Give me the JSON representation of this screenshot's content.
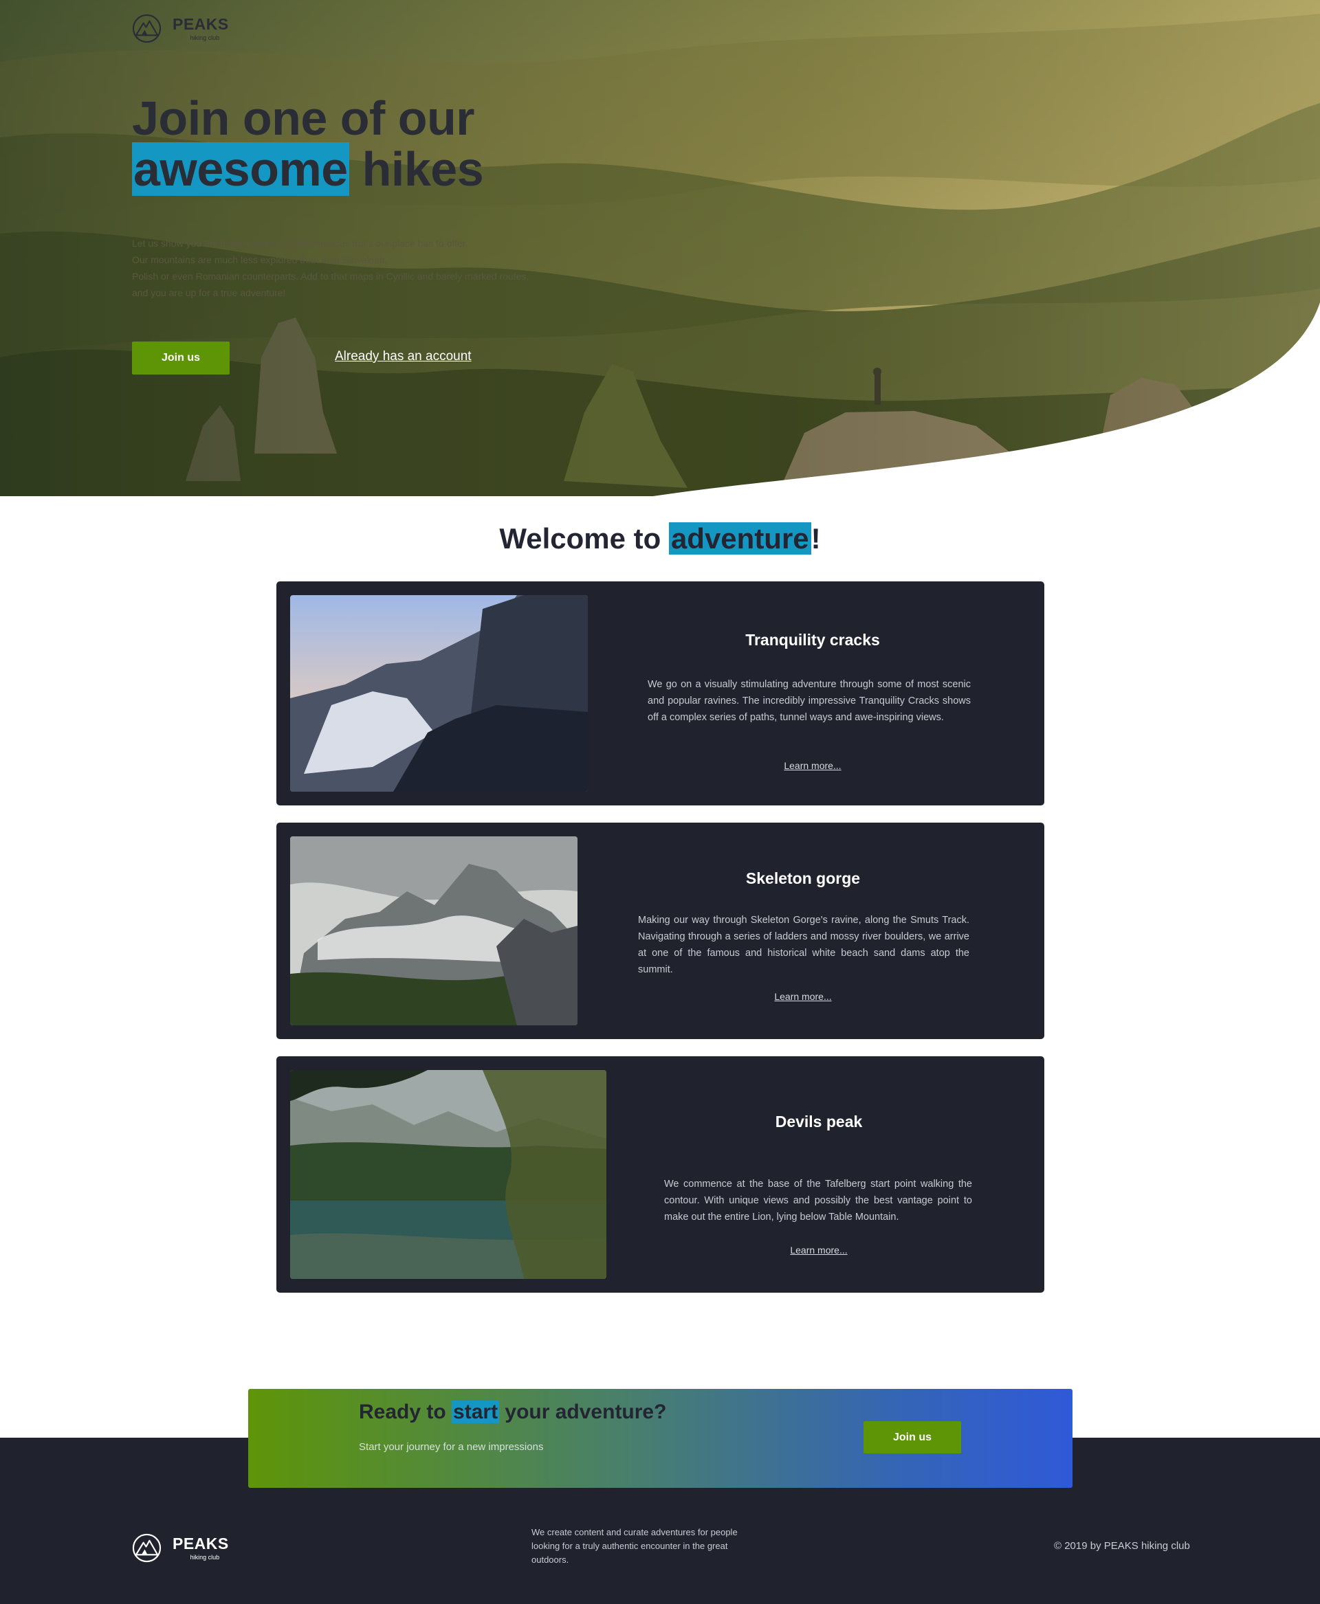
{
  "brand": {
    "name": "PEAKS",
    "sub": "hiking club"
  },
  "hero": {
    "title_line1": "Join one of our",
    "title_highlight": "awesome",
    "title_rest": " hikes",
    "text_lines": [
      "Let us show you the hidden gems and adventurous trails our place has to offer.",
      "Our mountains are much less explored than their Slovakian,",
      "Polish or even Romanian counterparts. Add to that maps in Cyrillic and barely marked routes,",
      "and you are up for a true adventure!"
    ],
    "join_label": "Join us",
    "account_link": "Already has an account"
  },
  "welcome": {
    "prefix": "Welcome to ",
    "highlight": "adventure",
    "suffix": "!"
  },
  "cards": [
    {
      "title": "Tranquility cracks",
      "description": "We go on a visually stimulating adventure through some of most scenic and popular ravines. The incredibly impressive Tranquility Cracks shows off a complex series of paths, tunnel ways and awe-inspiring views.",
      "link": "Learn more..."
    },
    {
      "title": "Skeleton gorge",
      "description": "Making our way through Skeleton Gorge's ravine, along the Smuts Track. Navigating through a series of ladders and mossy river boulders, we arrive at one of the famous and historical white beach sand dams atop the summit.",
      "link": "Learn more..."
    },
    {
      "title": "Devils peak",
      "description": "We commence at the base of the Tafelberg start point walking the contour. With unique views and possibly the best vantage point to make out the entire Lion, lying below Table Mountain.",
      "link": "Learn more..."
    }
  ],
  "cta": {
    "prefix": "Ready to ",
    "highlight": "start",
    "suffix": " your adventure?",
    "subtitle": "Start your journey for a new impressions",
    "join_label": "Join us"
  },
  "footer": {
    "text": "We create content and curate adventures for people looking for a truly authentic encounter in the great outdoors.",
    "copyright": "© 2019 by PEAKS hiking club"
  },
  "colors": {
    "accent_blue": "#1597c4",
    "button_green": "#5e9506",
    "dark_navy": "#20222e"
  }
}
